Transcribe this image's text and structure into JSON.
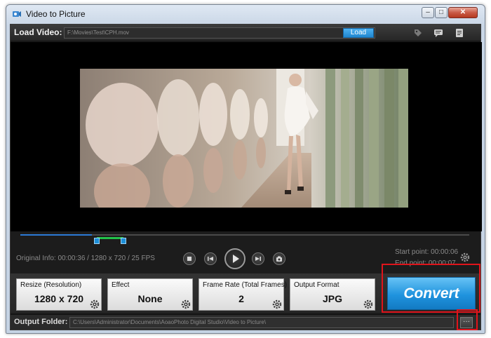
{
  "window": {
    "title": "Video to Picture",
    "min_glyph": "–",
    "max_glyph": "□",
    "close_glyph": "✕"
  },
  "load": {
    "label": "Load Video:",
    "path": "F:\\Movies\\Test\\CPH.mov",
    "button": "Load"
  },
  "toolbar_icons": [
    "tag-icon",
    "chat-icon",
    "list-icon"
  ],
  "info": {
    "original": "Original Info: 00:00:36 / 1280 x 720 / 25 FPS",
    "start_point": "Start point: 00:00:06",
    "end_point": "End point: 00:00:07"
  },
  "timeline": {
    "played_fraction": 0.16,
    "range_start_fraction": 0.17,
    "range_end_fraction": 0.23
  },
  "playback_controls": [
    "stop-icon",
    "previous-icon",
    "play-icon",
    "next-icon",
    "snapshot-icon"
  ],
  "panels": [
    {
      "label": "Resize (Resolution)",
      "value": "1280 x 720"
    },
    {
      "label": "Effect",
      "value": "None"
    },
    {
      "label": "Frame Rate (Total Frames)",
      "value": "2"
    },
    {
      "label": "Output Format",
      "value": "JPG"
    }
  ],
  "convert": {
    "label": "Convert"
  },
  "output": {
    "label": "Output Folder:",
    "path": "C:\\Users\\Administrator\\Documents\\AoaoPhoto Digital Studio\\Video to Picture\\",
    "browse": "···"
  },
  "colors": {
    "accent": "#1f93de",
    "highlight": "#e0141b",
    "range": "#22c24a"
  }
}
